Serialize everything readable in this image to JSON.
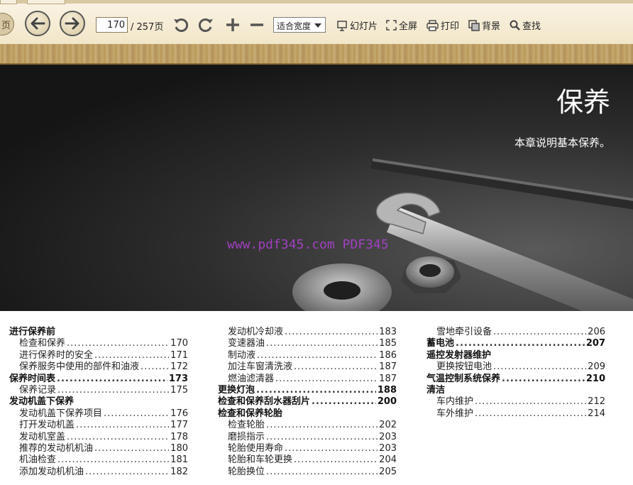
{
  "toolbar": {
    "prev_page_label": "页",
    "current_page": "170",
    "total_pages": "/ 257页",
    "zoom_option": "适合宽度",
    "slideshow_label": "幻灯片",
    "fullscreen_label": "全屏",
    "print_label": "打印",
    "background_label": "背景",
    "search_label": "查找"
  },
  "hero": {
    "title": "保养",
    "subtitle": "本章说明基本保养。"
  },
  "watermark": "www.pdf345.com PDF345",
  "toc": {
    "col1": [
      {
        "title": "进行保养前",
        "page": "",
        "level": "head"
      },
      {
        "title": "检查和保养",
        "page": "170",
        "level": "sub"
      },
      {
        "title": "进行保养时的安全",
        "page": "171",
        "level": "sub"
      },
      {
        "title": "保养服务中使用的部件和油液",
        "page": "172",
        "level": "sub"
      },
      {
        "title": "保养时间表",
        "page": "173",
        "level": "head"
      },
      {
        "title": "保养记录",
        "page": "175",
        "level": "sub"
      },
      {
        "title": "发动机盖下保养",
        "page": "",
        "level": "head"
      },
      {
        "title": "发动机盖下保养项目",
        "page": "176",
        "level": "sub"
      },
      {
        "title": "打开发动机盖",
        "page": "177",
        "level": "sub"
      },
      {
        "title": "发动机室盖",
        "page": "178",
        "level": "sub"
      },
      {
        "title": "推荐的发动机机油",
        "page": "180",
        "level": "sub"
      },
      {
        "title": "机油检查",
        "page": "181",
        "level": "sub"
      },
      {
        "title": "添加发动机机油",
        "page": "182",
        "level": "sub"
      }
    ],
    "col2": [
      {
        "title": "发动机冷却液",
        "page": "183",
        "level": "sub"
      },
      {
        "title": "变速器油",
        "page": "185",
        "level": "sub"
      },
      {
        "title": "制动液",
        "page": "186",
        "level": "sub"
      },
      {
        "title": "加注车窗清洗液",
        "page": "187",
        "level": "sub"
      },
      {
        "title": "燃油滤清器",
        "page": "187",
        "level": "sub"
      },
      {
        "title": "更换灯泡",
        "page": "188",
        "level": "head"
      },
      {
        "title": "检查和保养刮水器刮片",
        "page": "200",
        "level": "head"
      },
      {
        "title": "检查和保养轮胎",
        "page": "",
        "level": "head"
      },
      {
        "title": "检查轮胎",
        "page": "202",
        "level": "sub"
      },
      {
        "title": "磨损指示",
        "page": "203",
        "level": "sub"
      },
      {
        "title": "轮胎使用寿命",
        "page": "203",
        "level": "sub"
      },
      {
        "title": "轮胎和车轮更换",
        "page": "204",
        "level": "sub"
      },
      {
        "title": "轮胎换位",
        "page": "205",
        "level": "sub"
      }
    ],
    "col3": [
      {
        "title": "雪地牵引设备",
        "page": "206",
        "level": "sub"
      },
      {
        "title": "蓄电池",
        "page": "207",
        "level": "head"
      },
      {
        "title": "遥控发射器维护",
        "page": "",
        "level": "head"
      },
      {
        "title": "更换按钮电池",
        "page": "209",
        "level": "sub"
      },
      {
        "title": "气温控制系统保养",
        "page": "210",
        "level": "head"
      },
      {
        "title": "清洁",
        "page": "",
        "level": "head"
      },
      {
        "title": "车内维护",
        "page": "212",
        "level": "sub"
      },
      {
        "title": "车外维护",
        "page": "214",
        "level": "sub"
      }
    ]
  }
}
